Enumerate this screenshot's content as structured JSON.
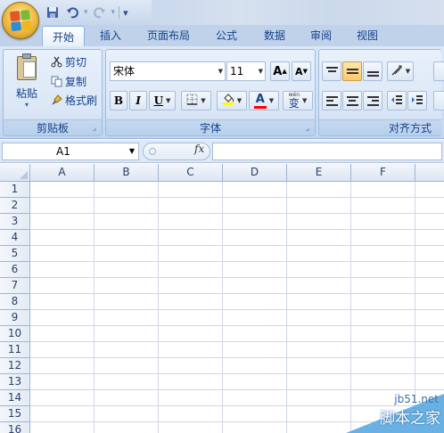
{
  "tabs": [
    "开始",
    "插入",
    "页面布局",
    "公式",
    "数据",
    "审阅",
    "视图"
  ],
  "active_tab": "开始",
  "clipboard": {
    "paste_label": "粘贴",
    "cut_label": "剪切",
    "copy_label": "复制",
    "format_painter_label": "格式刷",
    "group_label": "剪贴板"
  },
  "font": {
    "font_name": "宋体",
    "font_size": "11",
    "bold_label": "B",
    "italic_label": "I",
    "underline_label": "U",
    "font_color_label": "A",
    "pinyin_label": "变",
    "grow_label": "A",
    "shrink_label": "A",
    "group_label": "字体"
  },
  "alignment": {
    "group_label": "对齐方式"
  },
  "formula_bar": {
    "name_box": "A1",
    "fx_label": "fx",
    "formula": ""
  },
  "sheet": {
    "columns": [
      "A",
      "B",
      "C",
      "D",
      "E",
      "F"
    ],
    "rows": [
      "1",
      "2",
      "3",
      "4",
      "5",
      "6",
      "7",
      "8",
      "9",
      "10",
      "11",
      "12",
      "13",
      "14",
      "15",
      "16"
    ]
  },
  "watermark": {
    "url": "jb51.net",
    "name": "脚本之家"
  },
  "colors": {
    "ribbon_text": "#15428b",
    "grid_line": "#d0d7e5",
    "header_border": "#9eb6ce",
    "highlight_yellow": "#ffff00",
    "font_red": "#ff0000"
  },
  "icons": {
    "office_button": "office-logo-icon",
    "save": "save-icon",
    "undo": "undo-icon",
    "redo": "redo-icon"
  }
}
